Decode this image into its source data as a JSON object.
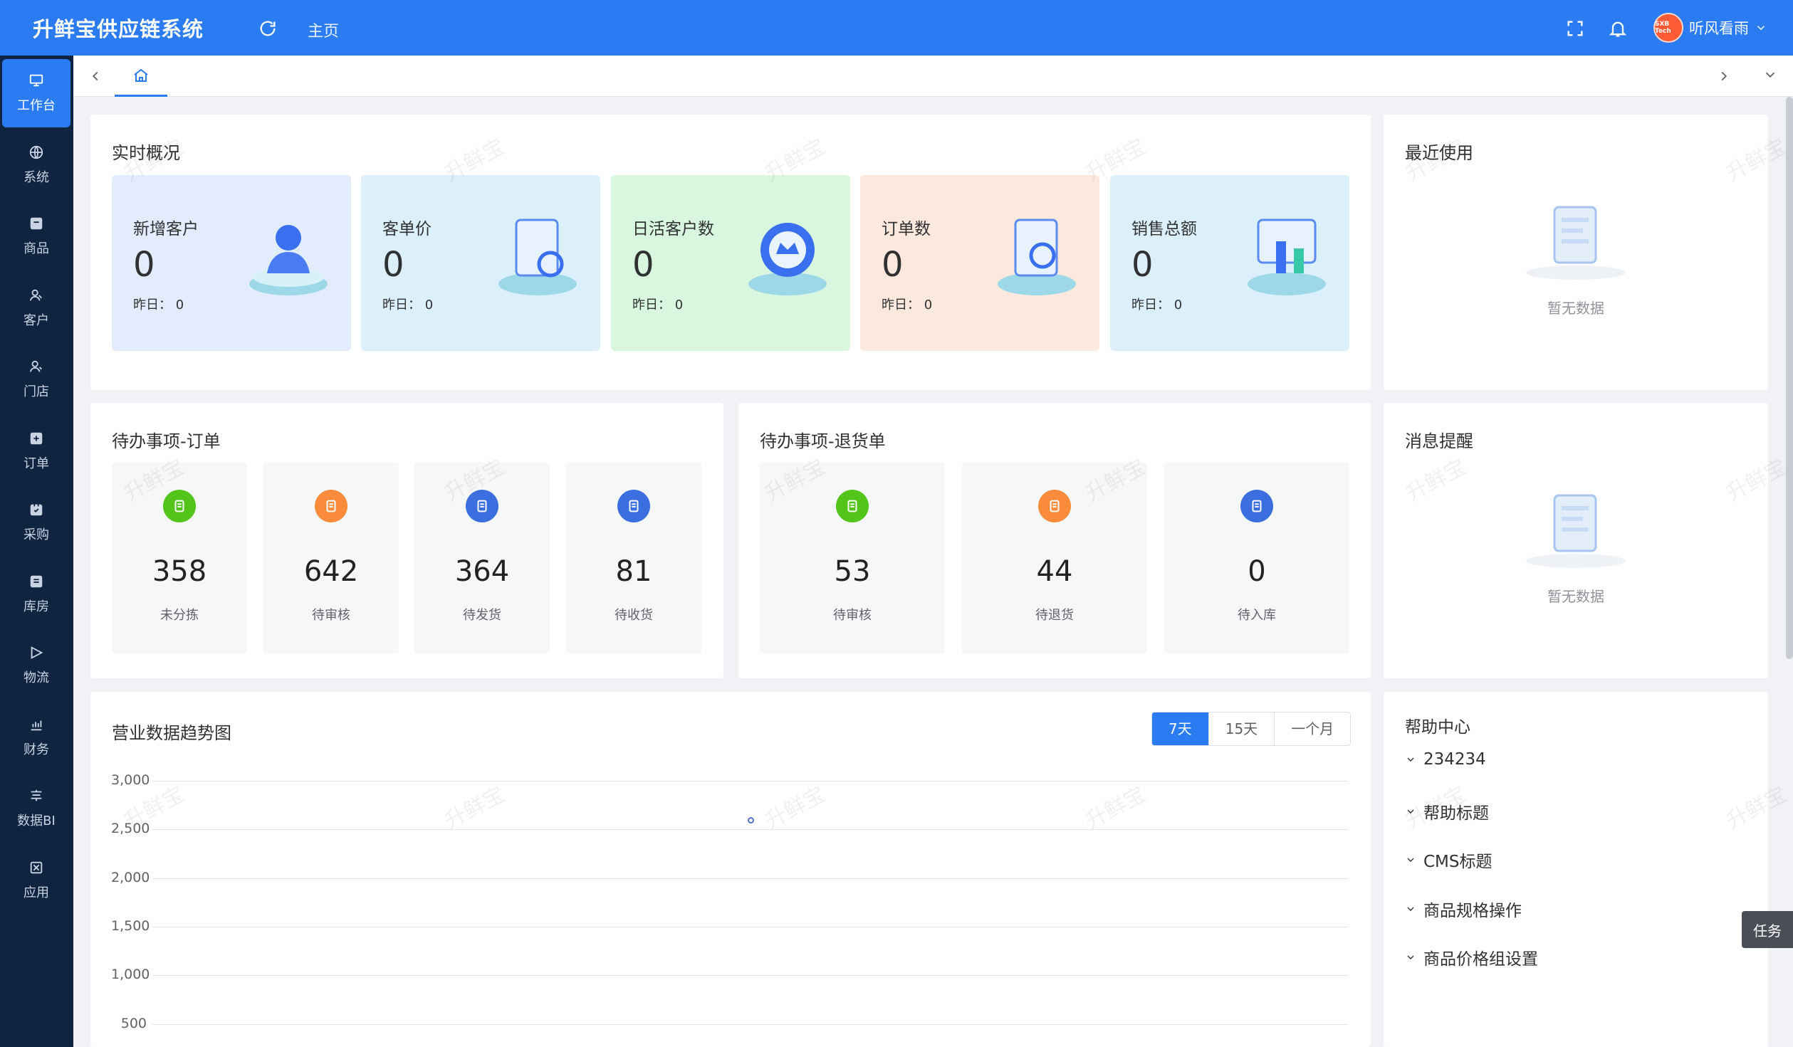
{
  "app": {
    "title": "升鲜宝供应链系统",
    "home_link": "主页",
    "user_name": "听风看雨",
    "avatar_text": "SXB Tech"
  },
  "colors": {
    "primary": "#2b7bf3",
    "sidebar": "#0f2440"
  },
  "sidebar": {
    "items": [
      {
        "label": "工作台",
        "icon": "monitor-icon"
      },
      {
        "label": "系统",
        "icon": "globe-icon"
      },
      {
        "label": "商品",
        "icon": "box-icon"
      },
      {
        "label": "客户",
        "icon": "users-icon"
      },
      {
        "label": "门店",
        "icon": "store-icon"
      },
      {
        "label": "订单",
        "icon": "order-icon"
      },
      {
        "label": "采购",
        "icon": "purchase-icon"
      },
      {
        "label": "库房",
        "icon": "warehouse-icon"
      },
      {
        "label": "物流",
        "icon": "send-icon"
      },
      {
        "label": "财务",
        "icon": "chart-icon"
      },
      {
        "label": "数据BI",
        "icon": "bi-icon"
      },
      {
        "label": "应用",
        "icon": "app-icon"
      }
    ]
  },
  "overview": {
    "title": "实时概况",
    "yesterday_label": "昨日：",
    "stats": [
      {
        "label": "新增客户",
        "value": "0",
        "yesterday": "0",
        "bg": "#e3ecfd"
      },
      {
        "label": "客单价",
        "value": "0",
        "yesterday": "0",
        "bg": "#dcf0fc"
      },
      {
        "label": "日活客户数",
        "value": "0",
        "yesterday": "0",
        "bg": "#d9f7df"
      },
      {
        "label": "订单数",
        "value": "0",
        "yesterday": "0",
        "bg": "#fde8dd"
      },
      {
        "label": "销售总额",
        "value": "0",
        "yesterday": "0",
        "bg": "#dcf0fc"
      }
    ]
  },
  "recent": {
    "title": "最近使用",
    "empty_text": "暂无数据"
  },
  "todo_orders": {
    "title": "待办事项-订单",
    "items": [
      {
        "value": "358",
        "label": "未分拣",
        "color": "#52c41a"
      },
      {
        "value": "642",
        "label": "待审核",
        "color": "#fa8c3b"
      },
      {
        "value": "364",
        "label": "待发货",
        "color": "#3b6fe0"
      },
      {
        "value": "81",
        "label": "待收货",
        "color": "#3b6fe0"
      }
    ]
  },
  "todo_returns": {
    "title": "待办事项-退货单",
    "items": [
      {
        "value": "53",
        "label": "待审核",
        "color": "#52c41a"
      },
      {
        "value": "44",
        "label": "待退货",
        "color": "#fa8c3b"
      },
      {
        "value": "0",
        "label": "待入库",
        "color": "#3b6fe0"
      }
    ]
  },
  "messages": {
    "title": "消息提醒",
    "empty_text": "暂无数据"
  },
  "trend": {
    "title": "营业数据趋势图",
    "ranges": [
      "7天",
      "15天",
      "一个月"
    ],
    "selected_range": "7天"
  },
  "chart_data": {
    "type": "line",
    "y_ticks": [
      "3,000",
      "2,500",
      "2,000",
      "1,500",
      "1,000",
      "500"
    ],
    "ylim": [
      0,
      3000
    ],
    "points": [
      {
        "x_frac": 0.5,
        "y": 2600
      }
    ]
  },
  "help": {
    "title": "帮助中心",
    "items": [
      "234234",
      "帮助标题",
      "CMS标题",
      "商品规格操作",
      "商品价格组设置"
    ]
  },
  "watermark": "升鲜宝",
  "task_button": "任务"
}
